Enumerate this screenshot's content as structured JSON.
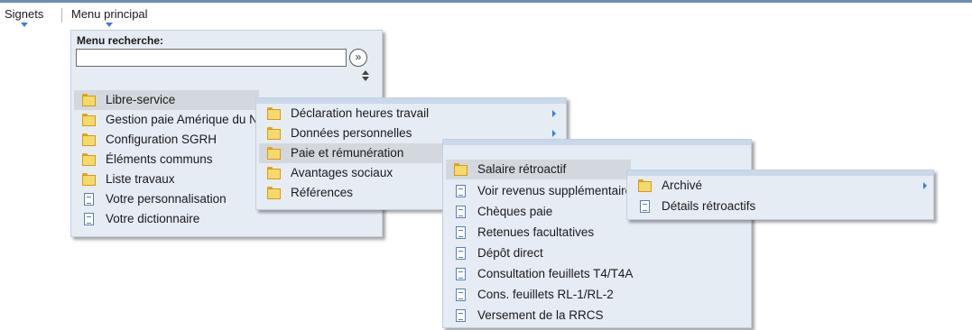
{
  "topbar": {
    "bookmarks_label": "Signets",
    "main_menu_label": "Menu principal"
  },
  "search": {
    "label": "Menu recherche:",
    "input_value": "",
    "go_symbol": "»"
  },
  "menu_level1": [
    {
      "label": "Libre-service",
      "icon": "folder-icon"
    },
    {
      "label": "Gestion paie Amérique du Nord",
      "icon": "folder-icon"
    },
    {
      "label": "Configuration SGRH",
      "icon": "folder-icon"
    },
    {
      "label": "Éléments communs",
      "icon": "folder-icon"
    },
    {
      "label": "Liste travaux",
      "icon": "folder-icon"
    },
    {
      "label": "Votre personnalisation",
      "icon": "document-icon"
    },
    {
      "label": "Votre dictionnaire",
      "icon": "document-icon"
    }
  ],
  "menu_level2": [
    {
      "label": "Déclaration heures travail",
      "icon": "folder-icon"
    },
    {
      "label": "Données personnelles",
      "icon": "folder-icon"
    },
    {
      "label": "Paie et rémunération",
      "icon": "folder-icon"
    },
    {
      "label": "Avantages sociaux",
      "icon": "folder-icon"
    },
    {
      "label": "Références",
      "icon": "folder-icon"
    }
  ],
  "menu_level3": [
    {
      "label": "Salaire rétroactif",
      "icon": "folder-icon"
    },
    {
      "label": "Voir revenus supplémentaires",
      "icon": "document-icon"
    },
    {
      "label": "Chèques paie",
      "icon": "document-icon"
    },
    {
      "label": "Retenues facultatives",
      "icon": "document-icon"
    },
    {
      "label": "Dépôt direct",
      "icon": "document-icon"
    },
    {
      "label": "Consultation feuillets T4/T4A",
      "icon": "document-icon"
    },
    {
      "label": "Cons. feuillets RL-1/RL-2",
      "icon": "document-icon"
    },
    {
      "label": "Versement de la RRCS",
      "icon": "document-icon"
    }
  ],
  "menu_level4": [
    {
      "label": "Archivé",
      "icon": "folder-icon"
    },
    {
      "label": "Détails rétroactifs",
      "icon": "document-icon"
    }
  ]
}
